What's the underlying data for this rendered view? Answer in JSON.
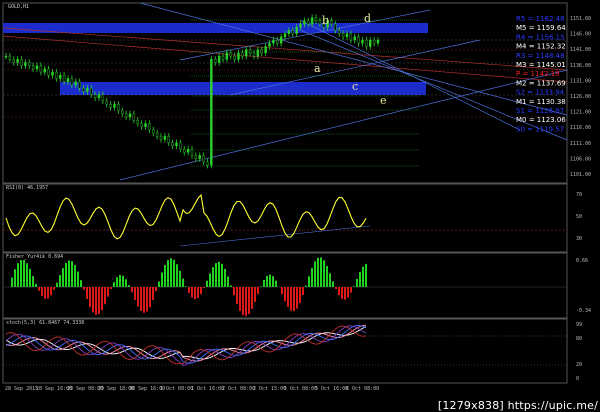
{
  "symbol_title": "GOLD,H1",
  "pivot_levels": [
    {
      "label": "R5",
      "value": "1162.48",
      "color": "#2b3bff"
    },
    {
      "label": "M5",
      "value": "1159.64",
      "color": "#ffffff"
    },
    {
      "label": "R4",
      "value": "1156.15",
      "color": "#2b3bff"
    },
    {
      "label": "M4",
      "value": "1152.32",
      "color": "#ffffff"
    },
    {
      "label": "R3",
      "value": "1148.48",
      "color": "#2b3bff"
    },
    {
      "label": "M3",
      "value": "1145.01",
      "color": "#ffffff"
    },
    {
      "label": "P",
      "value": "1142.19",
      "color": "#ff2020"
    },
    {
      "label": "M2",
      "value": "1137.69",
      "color": "#ffffff"
    },
    {
      "label": "S2",
      "value": "1133.94",
      "color": "#2b3bff"
    },
    {
      "label": "M1",
      "value": "1130.38",
      "color": "#ffffff"
    },
    {
      "label": "S1",
      "value": "1126.97",
      "color": "#2b3bff"
    },
    {
      "label": "M0",
      "value": "1123.06",
      "color": "#ffffff"
    },
    {
      "label": "S0",
      "value": "1119.57",
      "color": "#2b3bff"
    }
  ],
  "price_axis": [
    "1151.60",
    "1146.00",
    "1141.00",
    "1136.00",
    "1131.00",
    "1126.00",
    "1121.00",
    "1116.00",
    "1111.00",
    "1106.00",
    "1101.00"
  ],
  "wave_labels": [
    "b",
    "d",
    "a",
    "c",
    "e"
  ],
  "rsi": {
    "title": "RSI(8) 46.1957",
    "axis": [
      "70",
      "50",
      "30"
    ]
  },
  "fisher": {
    "title": "Fisher_Yur4ik 0.694",
    "axis": [
      "0.66",
      "-0.34"
    ]
  },
  "stoch": {
    "title": "stoch(5,3) 61.8467 74.3338",
    "axis": [
      "99",
      "80",
      "20",
      "0"
    ]
  },
  "time_axis": [
    "28 Sep 2015",
    "28 Sep 16:00",
    "29 Sep 08:00",
    "29 Sep 18:00",
    "30 Sep 16:00",
    "1 Oct 08:00",
    "1 Oct 16:00",
    "2 Oct 08:00",
    "2 Oct 15:00",
    "5 Oct 08:00",
    "5 Oct 16:00",
    "6 Oct 08:00"
  ],
  "credit": "[1279x838] https://upic.me/",
  "chart_data": {
    "type": "line",
    "title": "GOLD,H1",
    "ylim": [
      1101,
      1154
    ],
    "series": [
      {
        "values": [
          1139,
          1138,
          1137,
          1138,
          1136,
          1137,
          1136,
          1135,
          1136,
          1134,
          1135,
          1133,
          1134,
          1132,
          1133,
          1131,
          1132,
          1130,
          1131,
          1129,
          1128,
          1129,
          1127,
          1126,
          1127,
          1125,
          1124,
          1123,
          1124,
          1122,
          1121,
          1120,
          1121,
          1119,
          1118,
          1117,
          1118,
          1116,
          1115,
          1114,
          1113,
          1114,
          1112,
          1111,
          1112,
          1110,
          1109,
          1110,
          1108,
          1107,
          1108,
          1106,
          1105,
          1138,
          1137,
          1139,
          1138,
          1140,
          1139,
          1138,
          1140,
          1139,
          1141,
          1140,
          1139,
          1141,
          1140,
          1142,
          1143,
          1144,
          1143,
          1145,
          1146,
          1147,
          1146,
          1148,
          1149,
          1150,
          1149,
          1151,
          1150,
          1149,
          1148,
          1150,
          1149,
          1147,
          1146,
          1145,
          1146,
          1144,
          1145,
          1143,
          1144,
          1142,
          1144,
          1143,
          1144
        ]
      }
    ]
  }
}
